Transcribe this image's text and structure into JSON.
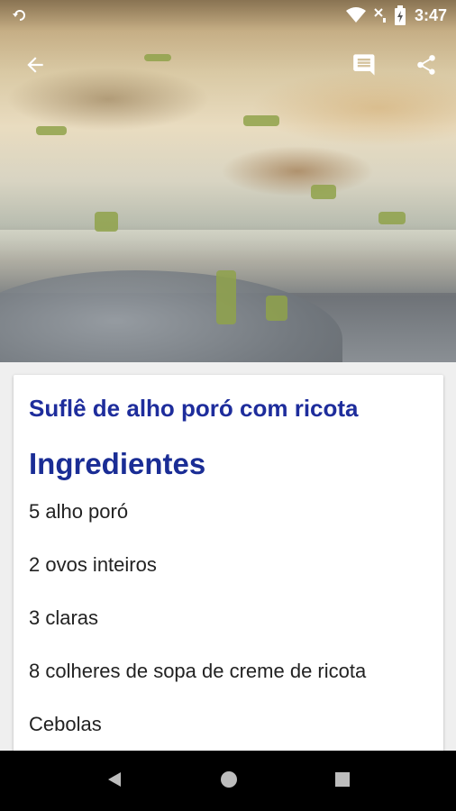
{
  "status_bar": {
    "time": "3:47",
    "icons": [
      "wifi-icon",
      "no-signal-icon",
      "battery-charging-icon"
    ]
  },
  "toolbar": {
    "back_icon": "arrow-back-icon",
    "comment_icon": "comment-icon",
    "share_icon": "share-icon"
  },
  "recipe": {
    "title": "Suflê de alho poró com ricota",
    "section_title": "Ingredientes",
    "ingredients": [
      "5 alho poró",
      "2 ovos inteiros",
      "3 claras",
      "8 colheres de sopa de creme de ricota",
      "Cebolas"
    ]
  },
  "nav_bar": {
    "icons": [
      "back-triangle-icon",
      "home-circle-icon",
      "recents-square-icon"
    ]
  },
  "colors": {
    "title": "#1e2d9c",
    "nav_bar": "#000000",
    "card": "#ffffff"
  }
}
